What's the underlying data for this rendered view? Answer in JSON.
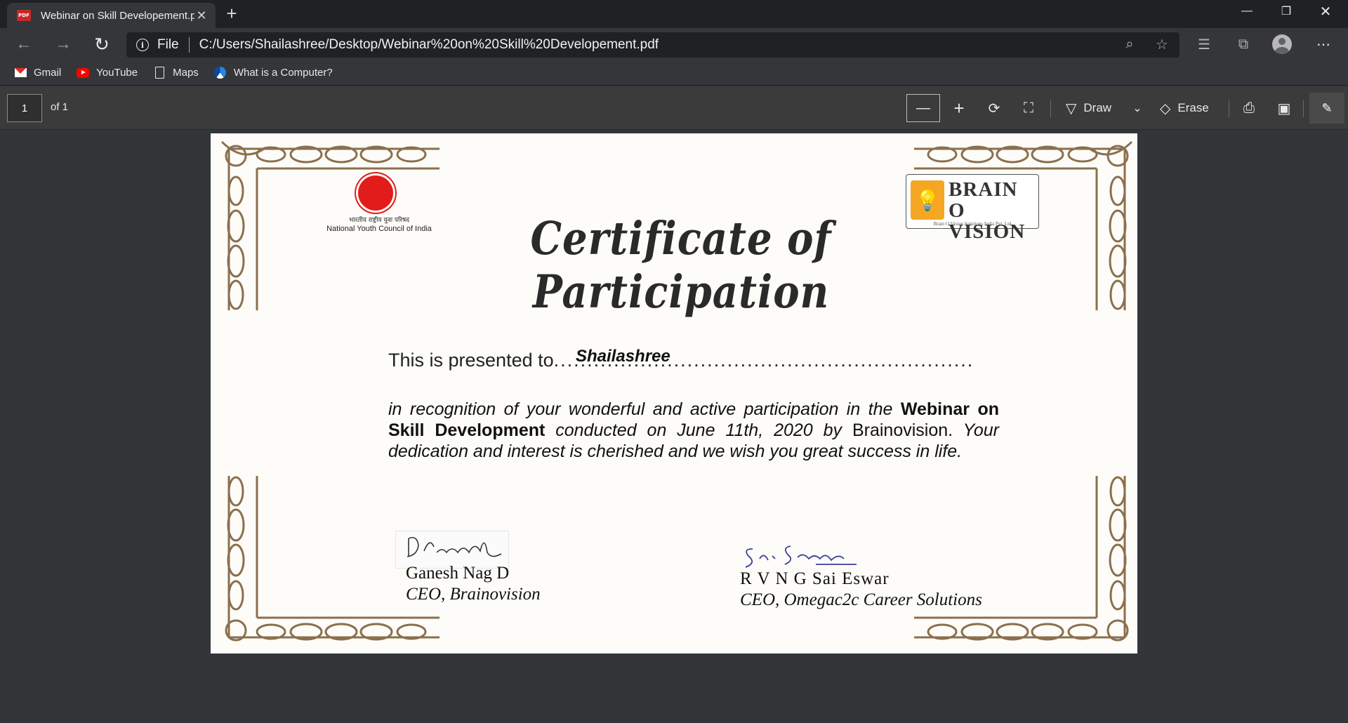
{
  "tab": {
    "title": "Webinar on Skill Developement.pdf",
    "favicon_label": "PDF"
  },
  "address": {
    "scheme": "File",
    "url": "C:/Users/Shailashree/Desktop/Webinar%20on%20Skill%20Developement.pdf"
  },
  "bookmarks": [
    {
      "label": "Gmail",
      "icon": "gmail-icon"
    },
    {
      "label": "YouTube",
      "icon": "youtube-icon"
    },
    {
      "label": "Maps",
      "icon": "page-icon"
    },
    {
      "label": "What is a Computer?",
      "icon": "webpage-icon"
    }
  ],
  "pdf_toolbar": {
    "page_number": "1",
    "page_count": "of 1",
    "draw_label": "Draw",
    "erase_label": "Erase"
  },
  "certificate": {
    "org_left_hindi": "भारतीय राष्ट्रीय युवा परिषद",
    "org_left_english": "National Youth Council of India",
    "logo_right_name": "BRAIN O VISION",
    "logo_right_sub": "Brain O Vision Solutions India Pvt. Ltd.",
    "title": "Certificate of Participation",
    "presented_label": "This is presented to",
    "recipient": "Shailashree",
    "body_1": "in recognition of your wonderful and active participation in the ",
    "body_bold": "Webinar on Skill Development",
    "body_2": " conducted on ",
    "body_date": "June 11th, 2020",
    "body_3": " by ",
    "body_org": "Brainovision.",
    "body_4": " Your dedication and interest is cherished and we wish you great success in life.",
    "signatory_1": {
      "name": "Ganesh Nag D",
      "title": "CEO, Brainovision"
    },
    "signatory_2": {
      "name": "R V N G Sai Eswar",
      "title": "CEO, Omegac2c Career Solutions"
    }
  },
  "colors": {
    "frame": "#8b6f4e",
    "accent_red": "#e21b1b",
    "bov_orange": "#f5a623"
  }
}
